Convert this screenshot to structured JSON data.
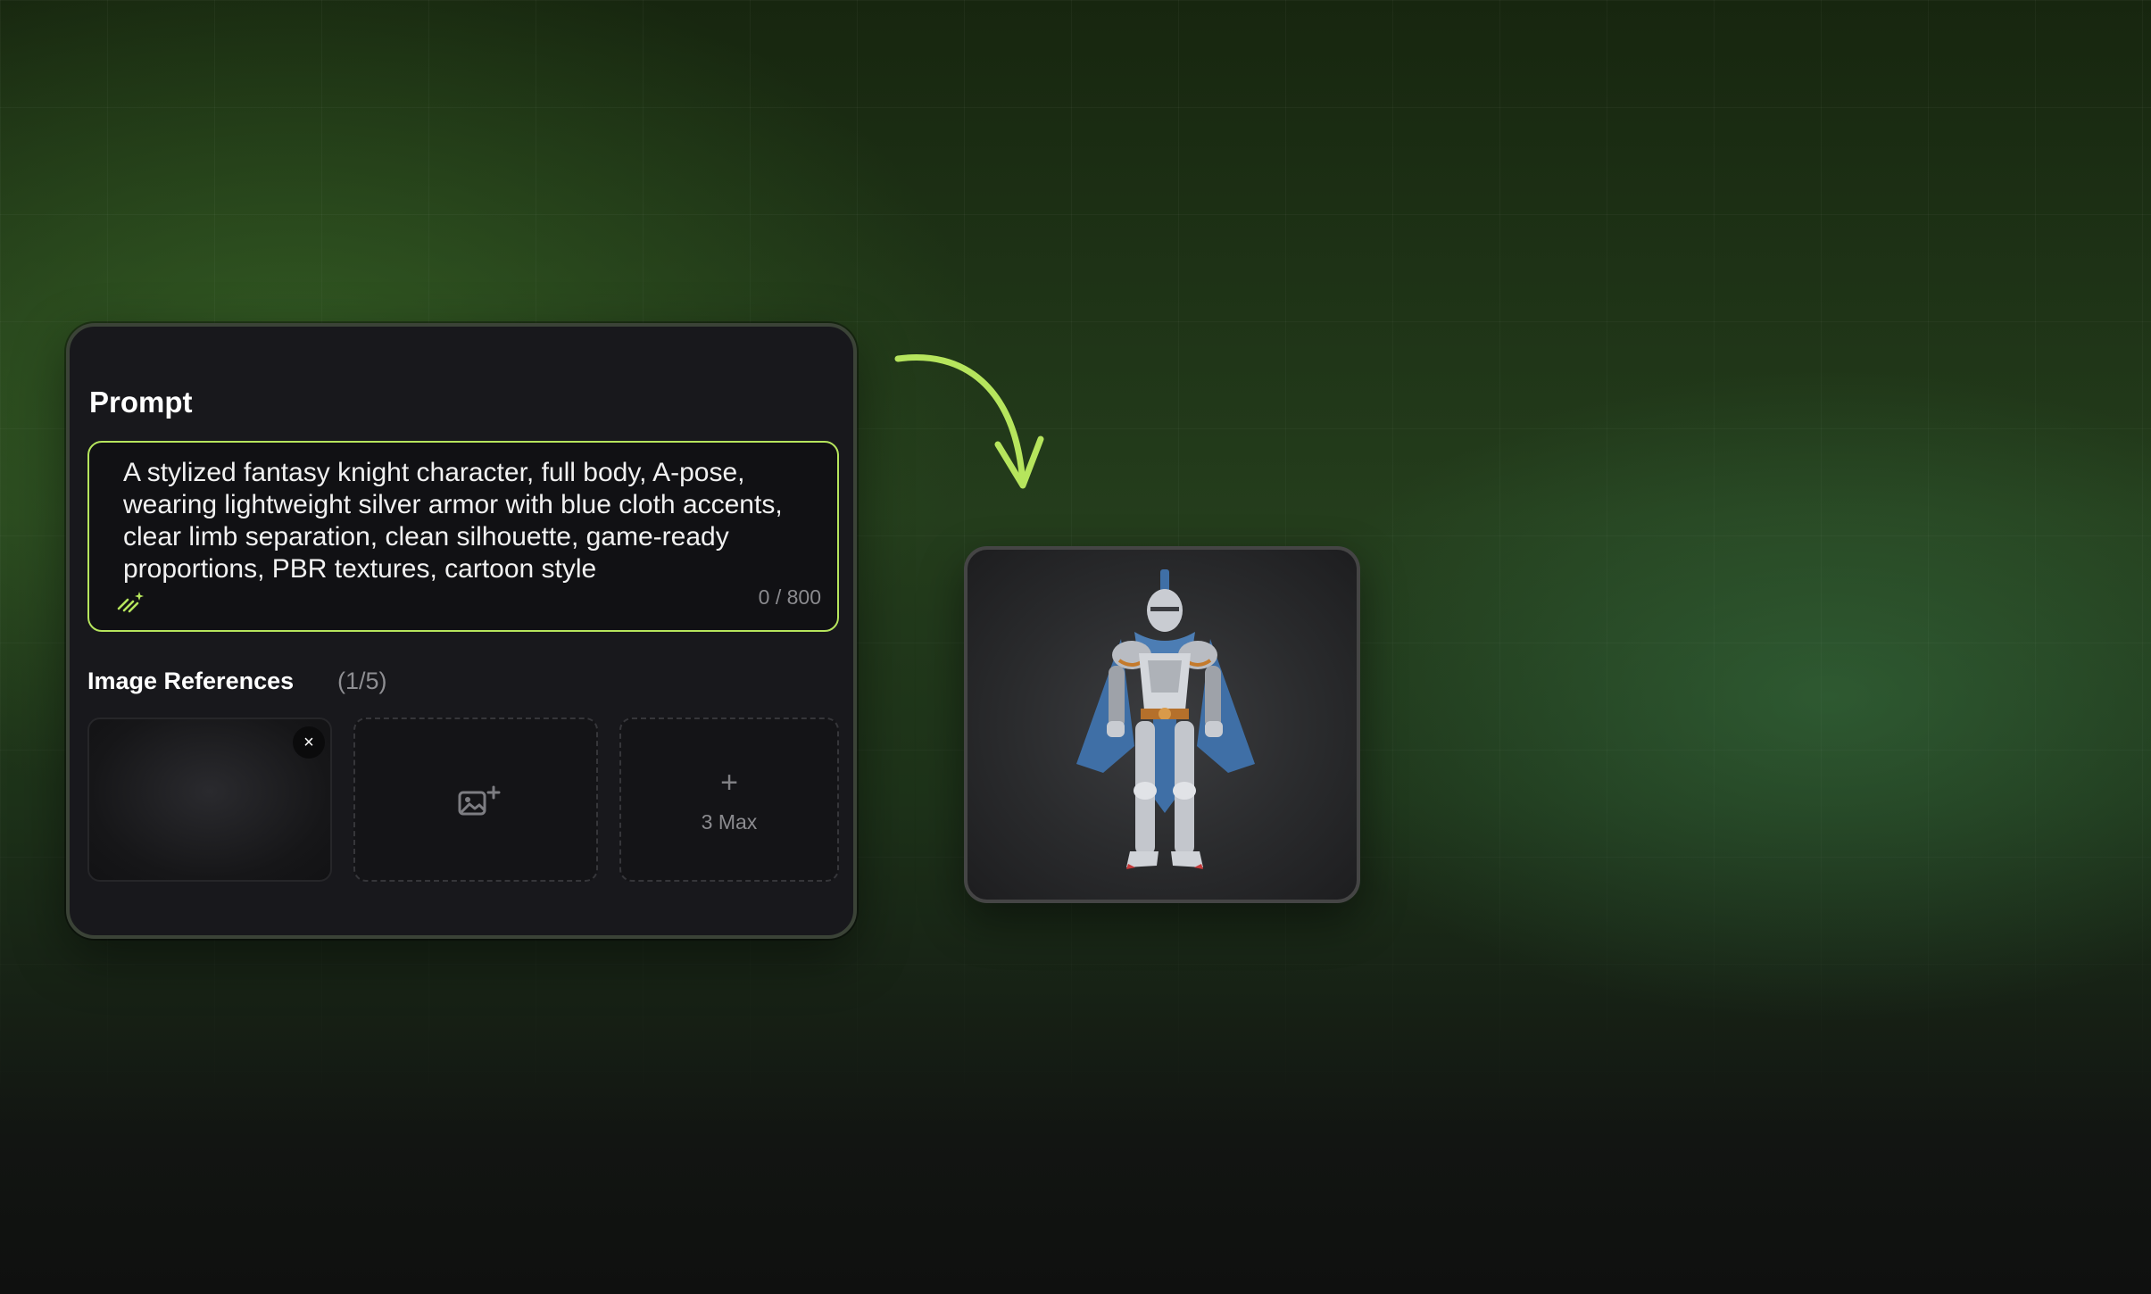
{
  "prompt": {
    "title": "Prompt",
    "text": "A stylized fantasy knight character, full body, A-pose, wearing lightweight silver armor with blue cloth accents, clear limb separation, clean silhouette, game-ready proportions, PBR textures, cartoon style",
    "char_count": "0 / 800",
    "enhance_icon": "magic-wand-icon"
  },
  "references": {
    "title": "Image References",
    "count": "(1/5)",
    "remove_icon": "close-icon",
    "remove_glyph": "×",
    "add_icon": "add-image-icon",
    "max_glyph": "+",
    "max_label": "3 Max"
  },
  "result": {
    "image": "knight-character-3d-render"
  },
  "colors": {
    "accent": "#b6e55d",
    "panel_bg": "#18181c",
    "page_bg": "#1d3219"
  }
}
